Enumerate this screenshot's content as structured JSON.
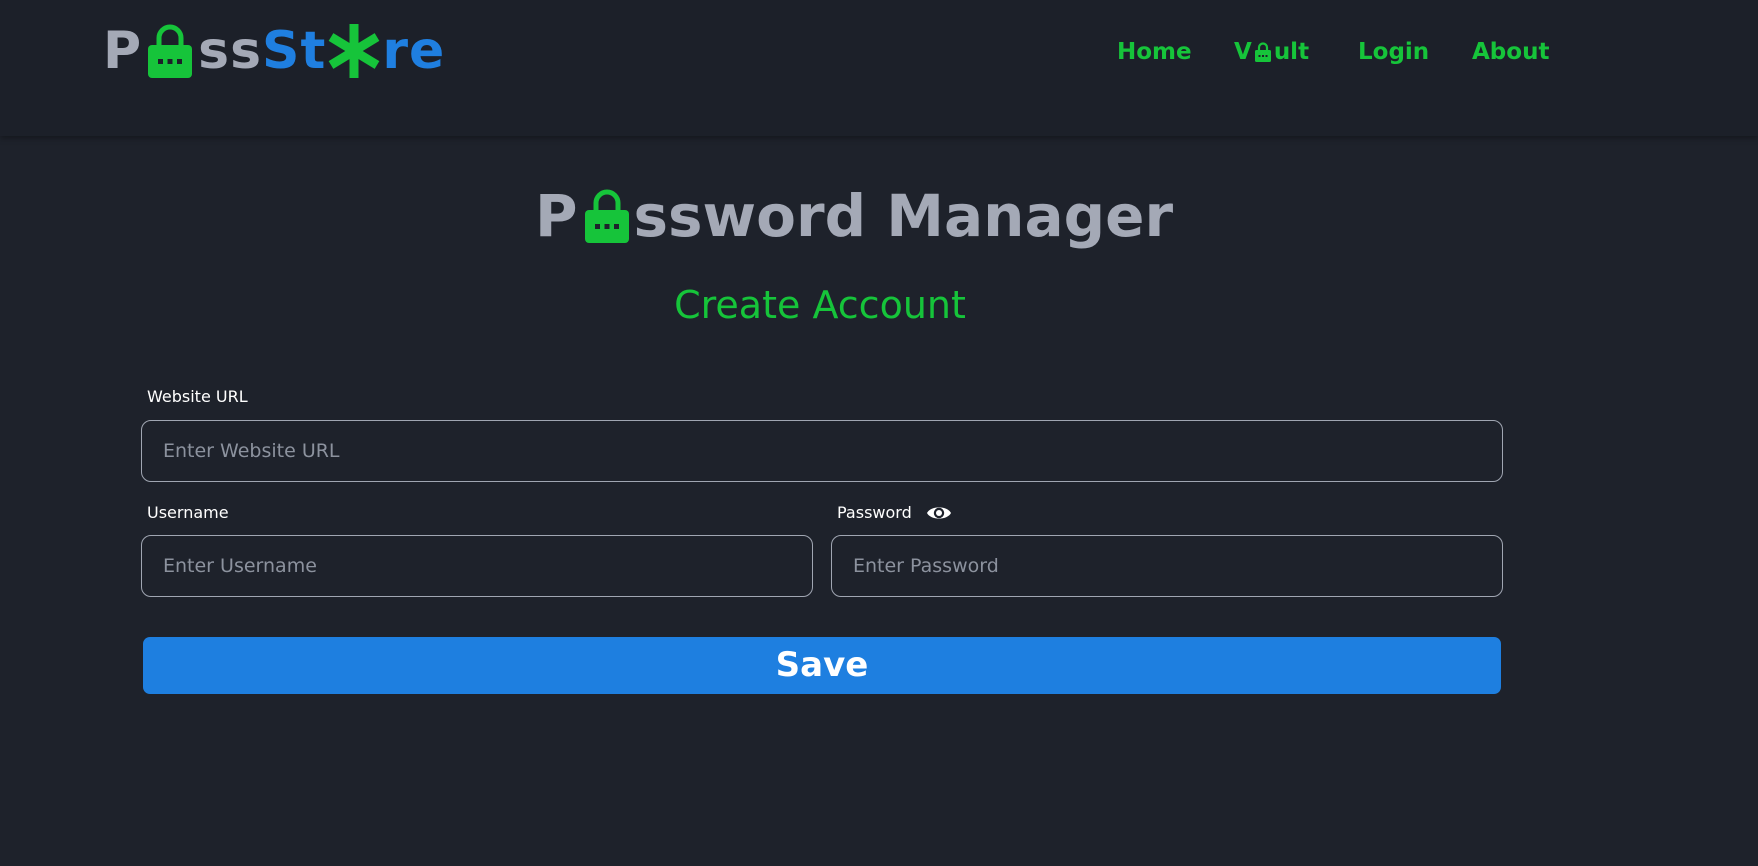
{
  "header": {
    "logo": {
      "part1": "P",
      "part2": "ss",
      "part3": "St",
      "part4": "re"
    },
    "nav": {
      "home": "Home",
      "vault_prefix": "V",
      "vault_suffix": "ult",
      "login": "Login",
      "about": "About"
    }
  },
  "main": {
    "title_prefix": "P",
    "title_suffix": "ssword Manager",
    "subtitle": "Create Account"
  },
  "form": {
    "website_label": "Website URL",
    "website_placeholder": "Enter Website URL",
    "website_value": "",
    "username_label": "Username",
    "username_placeholder": "Enter Username",
    "username_value": "",
    "password_label": "Password",
    "password_placeholder": "Enter Password",
    "password_value": "",
    "save_label": "Save"
  },
  "icons": {
    "lock": "lock-icon",
    "star": "asterisk-icon",
    "eye": "eye-icon"
  },
  "colors": {
    "background": "#1e222b",
    "header_background": "#1c2029",
    "accent_green": "#16c43a",
    "accent_blue": "#1e7fe0",
    "text_grey": "#a4a9b6"
  }
}
